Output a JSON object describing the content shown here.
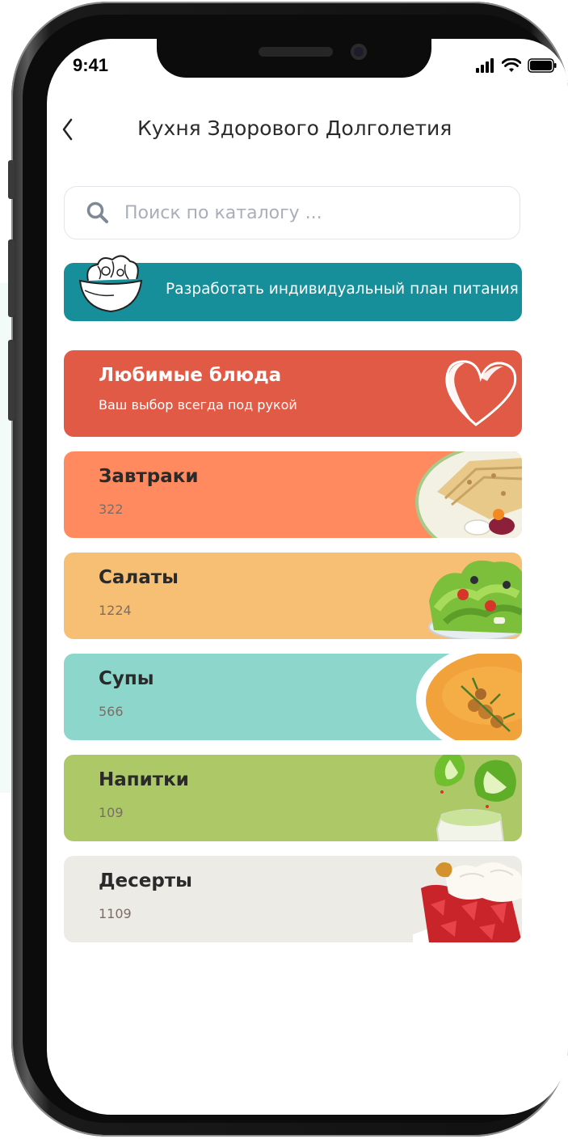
{
  "status_bar": {
    "time": "9:41"
  },
  "nav": {
    "title": "Кухня Здорового Долголетия"
  },
  "search": {
    "placeholder": "Поиск по каталогу ..."
  },
  "plan_banner": {
    "label": "Разработать индивидуальный план питания"
  },
  "colors": {
    "accent": "#178f9a",
    "favorites": "#e05a45",
    "breakfasts": "#ff8a5f",
    "salads": "#f7bf73",
    "soups": "#8dd6cb",
    "drinks": "#acc867",
    "desserts": "#ecebe6"
  },
  "favorites": {
    "title": "Любимые блюда",
    "subtitle": "Ваш выбор всегда под рукой",
    "icon": "heart-icon"
  },
  "categories": [
    {
      "title": "Завтраки",
      "count": "322",
      "image": "pancakes-image"
    },
    {
      "title": "Салаты",
      "count": "1224",
      "image": "salad-image"
    },
    {
      "title": "Супы",
      "count": "566",
      "image": "soup-image"
    },
    {
      "title": "Напитки",
      "count": "109",
      "image": "apple-drink-image"
    },
    {
      "title": "Десерты",
      "count": "1109",
      "image": "strawberry-dessert-image"
    }
  ]
}
